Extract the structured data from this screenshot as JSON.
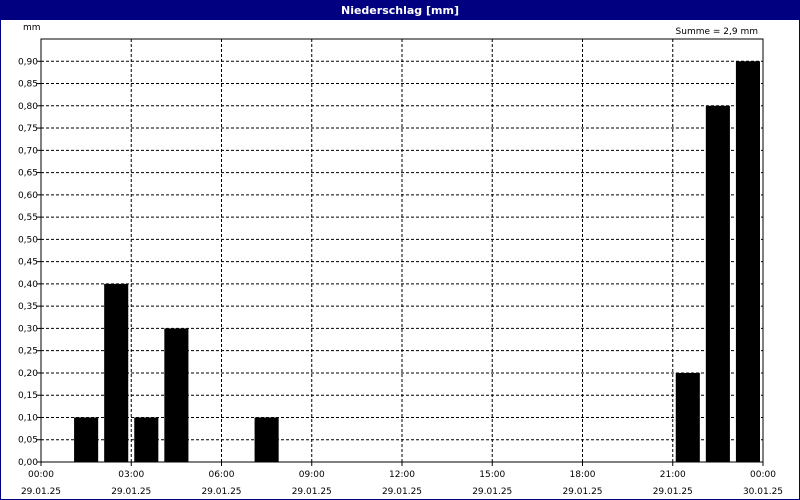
{
  "window": {
    "title": "Niederschlag [mm]"
  },
  "chart_data": {
    "type": "bar",
    "title": "Niederschlag [mm]",
    "ylabel": "mm",
    "annotation": "Summe = 2,9 mm",
    "ylim": [
      0,
      0.95
    ],
    "y_ticks": [
      "0,00",
      "0,05",
      "0,10",
      "0,15",
      "0,20",
      "0,25",
      "0,30",
      "0,35",
      "0,40",
      "0,45",
      "0,50",
      "0,55",
      "0,60",
      "0,65",
      "0,70",
      "0,75",
      "0,80",
      "0,85",
      "0,90"
    ],
    "x_range_hours": [
      0,
      24
    ],
    "x_ticks": [
      {
        "time": "00:00",
        "date": "29.01.25"
      },
      {
        "time": "03:00",
        "date": "29.01.25"
      },
      {
        "time": "06:00",
        "date": "29.01.25"
      },
      {
        "time": "09:00",
        "date": "29.01.25"
      },
      {
        "time": "12:00",
        "date": "29.01.25"
      },
      {
        "time": "15:00",
        "date": "29.01.25"
      },
      {
        "time": "18:00",
        "date": "29.01.25"
      },
      {
        "time": "21:00",
        "date": "29.01.25"
      },
      {
        "time": "00:00",
        "date": "30.01.25"
      }
    ],
    "categories": [
      "02:00",
      "03:00",
      "04:00",
      "05:00",
      "08:00",
      "22:00",
      "23:00",
      "00:00"
    ],
    "values": [
      0.1,
      0.4,
      0.1,
      0.3,
      0.1,
      0.2,
      0.8,
      0.9
    ],
    "grid": true,
    "bar_color": "#000000"
  }
}
